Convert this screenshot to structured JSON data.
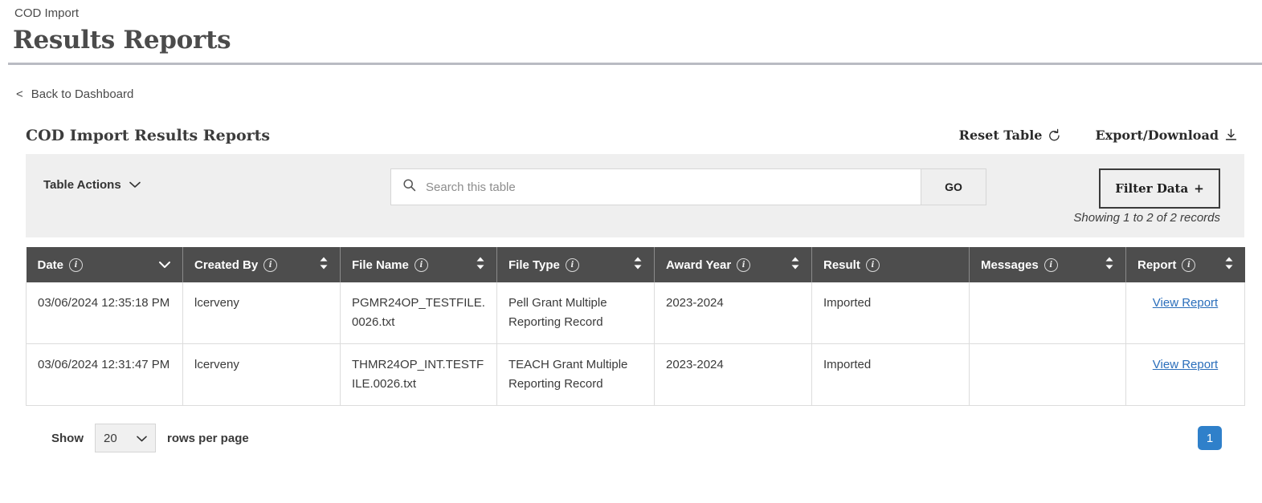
{
  "header": {
    "breadcrumb": "COD Import",
    "title": "Results Reports"
  },
  "back_link": {
    "chevron": "<",
    "label": "Back to Dashboard"
  },
  "card": {
    "title": "COD Import Results Reports",
    "reset_table_label": "Reset Table",
    "export_download_label": "Export/Download"
  },
  "toolbar": {
    "table_actions_label": "Table Actions",
    "search_placeholder": "Search this table",
    "search_value": "",
    "go_label": "GO",
    "filter_label": "Filter Data",
    "filter_plus": "+",
    "records_note": "Showing 1 to 2 of 2 records"
  },
  "table": {
    "columns": [
      {
        "label": "Date",
        "sort": "desc",
        "info": true
      },
      {
        "label": "Created By",
        "sort": "both",
        "info": true
      },
      {
        "label": "File Name",
        "sort": "both",
        "info": true
      },
      {
        "label": "File Type",
        "sort": "both",
        "info": true
      },
      {
        "label": "Award Year",
        "sort": "both",
        "info": true
      },
      {
        "label": "Result",
        "sort": "none",
        "info": true
      },
      {
        "label": "Messages",
        "sort": "both",
        "info": true
      },
      {
        "label": "Report",
        "sort": "both",
        "info": true
      }
    ],
    "rows": [
      {
        "date": "03/06/2024 12:35:18 PM",
        "created_by": "lcerveny",
        "file_name": "PGMR24OP_TESTFILE.0026.txt",
        "file_type": "Pell Grant Multiple Reporting Record",
        "award_year": "2023-2024",
        "result": "Imported",
        "messages": "",
        "report": "View Report"
      },
      {
        "date": "03/06/2024 12:31:47 PM",
        "created_by": "lcerveny",
        "file_name": "THMR24OP_INT.TESTFILE.0026.txt",
        "file_type": "TEACH Grant Multiple Reporting Record",
        "award_year": "2023-2024",
        "result": "Imported",
        "messages": "",
        "report": "View Report"
      }
    ]
  },
  "footer": {
    "show_label": "Show",
    "rows_value": "20",
    "rows_suffix": "rows per page",
    "pages": [
      "1"
    ]
  },
  "colors": {
    "header_bar": "#4d4d4d",
    "toolbar_bg": "#efefef",
    "link": "#2a6ebb",
    "page_active": "#2f80ca",
    "rule": "#b9bbc3"
  }
}
